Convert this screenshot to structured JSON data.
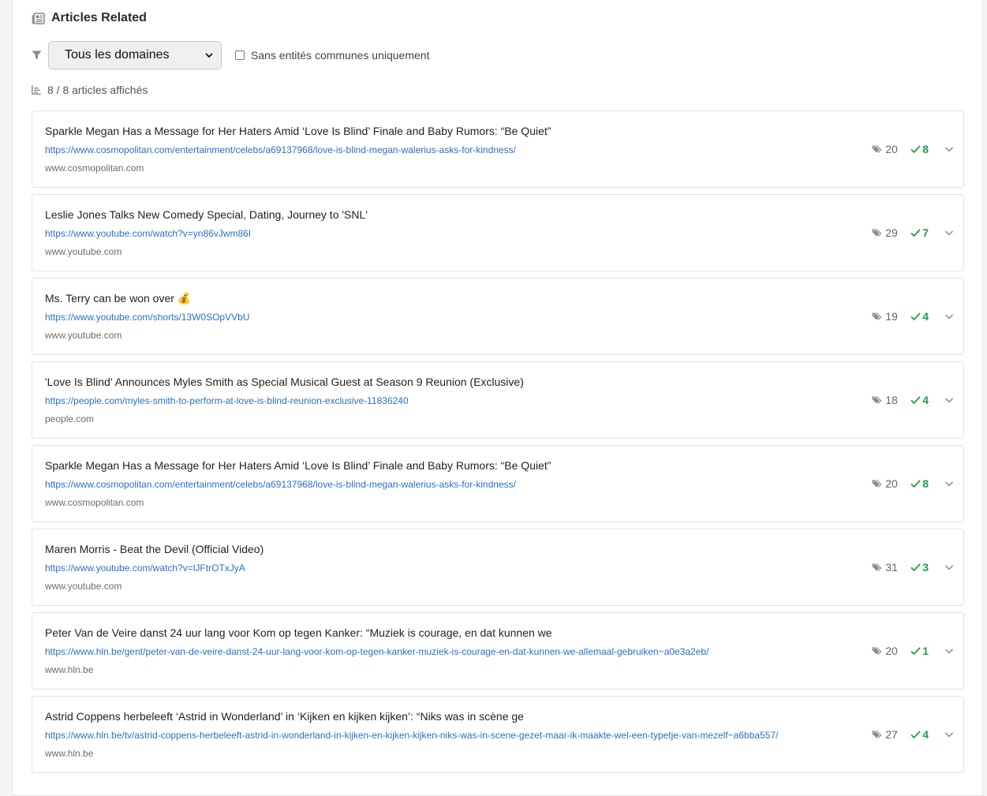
{
  "header": {
    "title": "Articles Related",
    "icon": "newspaper-icon"
  },
  "filters": {
    "domain_select_value": "Tous les domaines",
    "checkbox_label": "Sans entités communes uniquement",
    "checkbox_checked": false
  },
  "summary": {
    "count_text": "8 / 8 articles affichés"
  },
  "colors": {
    "link": "#2a6fc9",
    "match": "#1f9d48"
  },
  "articles": [
    {
      "title": "Sparkle Megan Has a Message for Her Haters Amid ‘Love Is Blind’ Finale and Baby Rumors: “Be Quiet”",
      "url": "https://www.cosmopolitan.com/entertainment/celebs/a69137968/love-is-blind-megan-walerius-asks-for-kindness/",
      "domain": "www.cosmopolitan.com",
      "entities": "20",
      "matches": "8"
    },
    {
      "title": "Leslie Jones Talks New Comedy Special, Dating, Journey to 'SNL'",
      "url": "https://www.youtube.com/watch?v=yn86vJwm86I",
      "domain": "www.youtube.com",
      "entities": "29",
      "matches": "7"
    },
    {
      "title": "Ms. Terry can be won over 💰",
      "url": "https://www.youtube.com/shorts/13W0SOpVVbU",
      "domain": "www.youtube.com",
      "entities": "19",
      "matches": "4"
    },
    {
      "title": "'Love Is Blind' Announces Myles Smith as Special Musical Guest at Season 9 Reunion (Exclusive)",
      "url": "https://people.com/myles-smith-to-perform-at-love-is-blind-reunion-exclusive-11836240",
      "domain": "people.com",
      "entities": "18",
      "matches": "4"
    },
    {
      "title": "Sparkle Megan Has a Message for Her Haters Amid ‘Love Is Blind’ Finale and Baby Rumors: “Be Quiet”",
      "url": "https://www.cosmopolitan.com/entertainment/celebs/a69137968/love-is-blind-megan-walerius-asks-for-kindness/",
      "domain": "www.cosmopolitan.com",
      "entities": "20",
      "matches": "8"
    },
    {
      "title": "Maren Morris - Beat the Devil (Official Video)",
      "url": "https://www.youtube.com/watch?v=lJFtrOTxJyA",
      "domain": "www.youtube.com",
      "entities": "31",
      "matches": "3"
    },
    {
      "title": "Peter Van de Veire danst 24 uur lang voor Kom op tegen Kanker: “Muziek is courage, en dat kunnen we",
      "url": "https://www.hln.be/gent/peter-van-de-veire-danst-24-uur-lang-voor-kom-op-tegen-kanker-muziek-is-courage-en-dat-kunnen-we-allemaal-gebruiken~a0e3a2eb/",
      "domain": "www.hln.be",
      "entities": "20",
      "matches": "1"
    },
    {
      "title": "Astrid Coppens herbeleeft ‘Astrid in Wonderland’ in ‘Kijken en kijken kijken’: “Niks was in scène ge",
      "url": "https://www.hln.be/tv/astrid-coppens-herbeleeft-astrid-in-wonderland-in-kijken-en-kijken-kijken-niks-was-in-scene-gezet-maar-ik-maakte-wel-een-typetje-van-mezelf~a6bba557/",
      "domain": "www.hln.be",
      "entities": "27",
      "matches": "4"
    }
  ]
}
